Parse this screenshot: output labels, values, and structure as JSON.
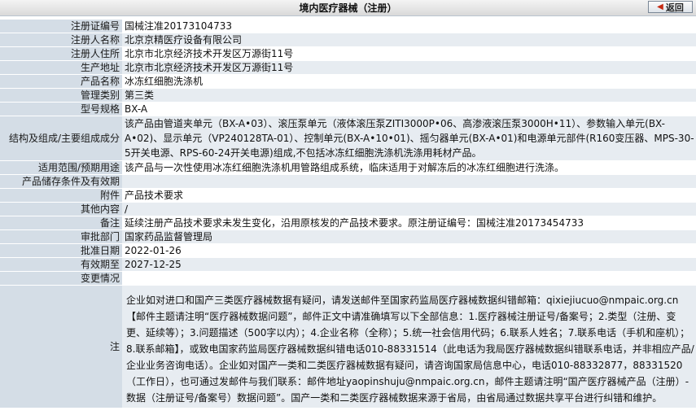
{
  "header": {
    "title": "境内医疗器械（注册）",
    "back_label": "返回"
  },
  "rows": [
    {
      "label": "注册证编号",
      "value": "国械注准20173104733"
    },
    {
      "label": "注册人名称",
      "value": "北京京精医疗设备有限公司"
    },
    {
      "label": "注册人住所",
      "value": "北京市北京经济技术开发区万源街11号"
    },
    {
      "label": "生产地址",
      "value": "北京市北京经济技术开发区万源街11号"
    },
    {
      "label": "产品名称",
      "value": "冰冻红细胞洗涤机"
    },
    {
      "label": "管理类别",
      "value": "第三类"
    },
    {
      "label": "型号规格",
      "value": "BX-A"
    },
    {
      "label": "结构及组成/主要组成成分",
      "value": "该产品由管道夹单元（BX-A•03）、滚压泵单元（液体滚压泵ZITI3000P•06、高渗液滚压泵3000H•11）、参数输入单元(BX-A•02)、显示单元（VP240128TA-01）、控制单元(BX-A•10•01)、摇匀器单元(BX-A•01)和电源单元部件(R160变压器、MPS-30-5开关电源、RPS-60-24开关电源)组成,不包括冰冻红细胞洗涤机洗涤用耗材产品。"
    },
    {
      "label": "适用范围/预期用途",
      "value": "该产品与一次性使用冰冻红细胞洗涤机用管路组成系统，临床适用于对解冻后的冰冻红细胞进行洗涤。"
    },
    {
      "label": "产品储存条件及有效期",
      "value": ""
    },
    {
      "label": "附件",
      "value": "产品技术要求"
    },
    {
      "label": "其他内容",
      "value": "/"
    },
    {
      "label": "备注",
      "value": "延续注册产品技术要求未发生变化，沿用原核发的产品技术要求。原注册证编号：国械注准20173454733"
    },
    {
      "label": "审批部门",
      "value": "国家药品监督管理局"
    },
    {
      "label": "批准日期",
      "value": "2022-01-26"
    },
    {
      "label": "有效期至",
      "value": "2027-12-25"
    },
    {
      "label": "变更情况",
      "value": ""
    }
  ],
  "note": {
    "label": "注",
    "text": "企业如对进口和国产三类医疗器械数据有疑问，请发送邮件至国家药监局医疗器械数据纠错邮箱：qixiejiucuo@nmpaic.org.cn【邮件主题请注明“医疗器械数据问题”，邮件正文中请准确填写以下全部信息：1.医疗器械注册证号/备案号；2.类型（注册、变更、延续等）；3.问题描述（500字以内）；4.企业名称（全称）；5.统一社会信用代码；6.联系人姓名；7.联系电话（手机和座机）；8.联系邮箱】，或致电国家药监局医疗器械数据纠错电话010-88331514（此电话为我局医疗器械数据纠错联系电话，并非相应产品/企业业务咨询电话）。企业如对国产一类和二类医疗器械数据有疑问，请咨询国家局信息中心，电话010-88332877，88331520（工作日），也可通过发邮件与我们联系：邮件地址yaopinshuju@nmpaic.org.cn，邮件主题请注明“国产医疗器械产品（注册）-数据（注册证号/备案号）数据问题”。国产一类和二类医疗器械数据来源于省局，由省局通过数据共享平台进行纠错和维护。"
  }
}
